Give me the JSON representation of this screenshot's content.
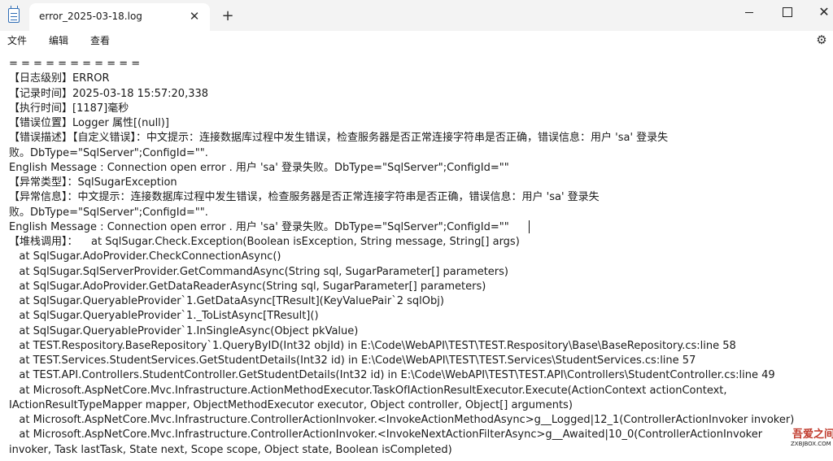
{
  "tab": {
    "title": "error_2025-03-18.log"
  },
  "menu": {
    "items": [
      "文件",
      "编辑",
      "查看"
    ]
  },
  "icons": {
    "app": "notepad-icon",
    "close_tab": "close-icon",
    "new_tab": "plus-icon",
    "settings": "gear-icon"
  },
  "log_lines": [
    "= = = = = = = = = = =",
    "【日志级别】ERROR",
    "【记录时间】2025-03-18 15:57:20,338",
    "【执行时间】[1187]毫秒",
    "【错误位置】Logger 属性[(null)]",
    "【错误描述】【自定义错误】：中文提示：连接数据库过程中发生错误，检查服务器是否正常连接字符串是否正确，错误信息：用户 'sa' 登录失",
    "败。DbType=\"SqlServer\";ConfigId=\"\".",
    "English Message : Connection open error . 用户 'sa' 登录失败。DbType=\"SqlServer\";ConfigId=\"\"",
    "【异常类型】：SqlSugarException",
    "【异常信息】：中文提示：连接数据库过程中发生错误，检查服务器是否正常连接字符串是否正确，错误信息：用户 'sa' 登录失",
    "败。DbType=\"SqlServer\";ConfigId=\"\".",
    "English Message : Connection open error . 用户 'sa' 登录失败。DbType=\"SqlServer\";ConfigId=\"\"",
    "【堆栈调用】：    at SqlSugar.Check.Exception(Boolean isException, String message, String[] args)",
    "   at SqlSugar.AdoProvider.CheckConnectionAsync()",
    "   at SqlSugar.SqlServerProvider.GetCommandAsync(String sql, SugarParameter[] parameters)",
    "   at SqlSugar.AdoProvider.GetDataReaderAsync(String sql, SugarParameter[] parameters)",
    "   at SqlSugar.QueryableProvider`1.GetDataAsync[TResult](KeyValuePair`2 sqlObj)",
    "   at SqlSugar.QueryableProvider`1._ToListAsync[TResult]()",
    "   at SqlSugar.QueryableProvider`1.InSingleAsync(Object pkValue)",
    "   at TEST.Respository.BaseRepository`1.QueryByID(Int32 objId) in E:\\Code\\WebAPI\\TEST\\TEST.Respository\\Base\\BaseRepository.cs:line 58",
    "   at TEST.Services.StudentServices.GetStudentDetails(Int32 id) in E:\\Code\\WebAPI\\TEST\\TEST.Services\\StudentServices.cs:line 57",
    "   at TEST.API.Controllers.StudentController.GetStudentDetails(Int32 id) in E:\\Code\\WebAPI\\TEST\\TEST.API\\Controllers\\StudentController.cs:line 49",
    "   at Microsoft.AspNetCore.Mvc.Infrastructure.ActionMethodExecutor.TaskOfIActionResultExecutor.Execute(ActionContext actionContext,",
    "IActionResultTypeMapper mapper, ObjectMethodExecutor executor, Object controller, Object[] arguments)",
    "   at Microsoft.AspNetCore.Mvc.Infrastructure.ControllerActionInvoker.<InvokeActionMethodAsync>g__Logged|12_1(ControllerActionInvoker invoker)",
    "   at Microsoft.AspNetCore.Mvc.Infrastructure.ControllerActionInvoker.<InvokeNextActionFilterAsync>g__Awaited|10_0(ControllerActionInvoker",
    "invoker, Task lastTask, State next, Scope scope, Object state, Boolean isCompleted)"
  ],
  "watermark": {
    "text": "吾爱之间",
    "sub": "ZXBJBOX.COM"
  }
}
